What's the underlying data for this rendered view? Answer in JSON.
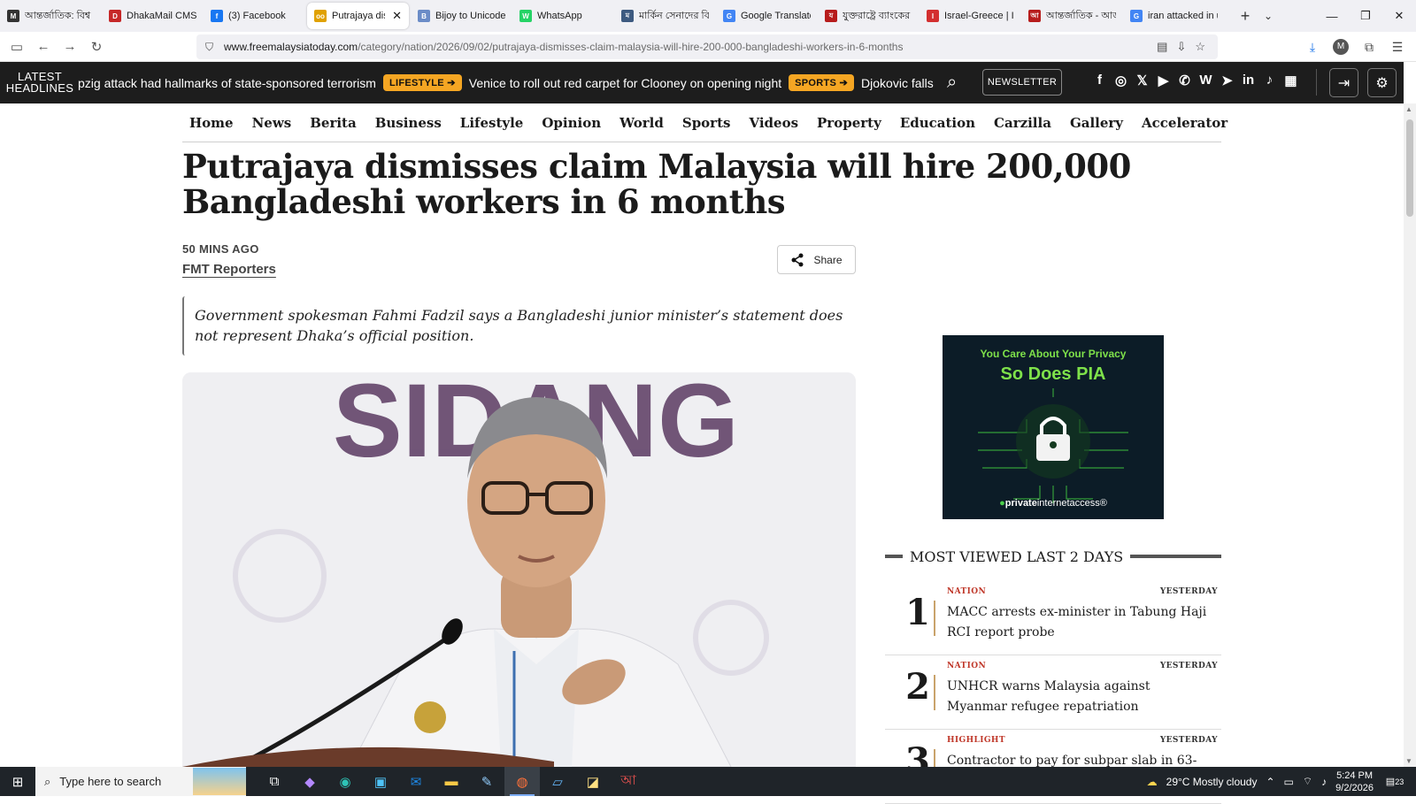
{
  "browser": {
    "tabs": [
      {
        "title": "আন্তর্জাতিক: বিশ্ব",
        "color": "#333333",
        "glyph": "M"
      },
      {
        "title": "DhakaMail CMS",
        "color": "#c62828",
        "glyph": "D"
      },
      {
        "title": "(3) Facebook",
        "color": "#1877f2",
        "glyph": "f"
      },
      {
        "title": "Putrajaya dism",
        "color": "#e0a100",
        "glyph": "oo",
        "active": true
      },
      {
        "title": "Bijoy to Unicode",
        "color": "#6b8cc7",
        "glyph": "B"
      },
      {
        "title": "WhatsApp",
        "color": "#25d366",
        "glyph": "W"
      },
      {
        "title": "মার্কিন সেনাদের বি",
        "color": "#3d5a80",
        "glyph": "ম"
      },
      {
        "title": "Google Translate",
        "color": "#4285f4",
        "glyph": "G"
      },
      {
        "title": "যুক্তরাষ্ট্রে ব্যাংকের",
        "color": "#b71c1c",
        "glyph": "য"
      },
      {
        "title": "Israel-Greece | Isr",
        "color": "#d32f2f",
        "glyph": "I"
      },
      {
        "title": "আন্তর্জাতিক - আজ",
        "color": "#b71c1c",
        "glyph": "আ"
      },
      {
        "title": "iran attacked in us",
        "color": "#4285f4",
        "glyph": "G"
      }
    ],
    "url_domain": "www.freemalaysiatoday.com",
    "url_path": "/category/nation/2026/09/02/putrajaya-dismisses-claim-malaysia-will-hire-200-000-bangladeshi-workers-in-6-months"
  },
  "headlines": {
    "label_line1": "LATEST",
    "label_line2": "HEADLINES",
    "item1": "pzig attack had hallmarks of state-sponsored terrorism",
    "cat1": "LIFESTYLE ➔",
    "item2": "Venice to roll out red carpet for Clooney on opening night",
    "cat2": "SPORTS ➔",
    "item3": "Djokovic falls in US O",
    "newsletter": "NEWSLETTER",
    "socials": [
      "f",
      "◎",
      "𝕏",
      "▶",
      "✆",
      "W",
      "➤",
      "in",
      "♪",
      "▦"
    ]
  },
  "menu": [
    "Home",
    "News",
    "Berita",
    "Business",
    "Lifestyle",
    "Opinion",
    "World",
    "Sports",
    "Videos",
    "Property",
    "Education",
    "Carzilla",
    "Gallery",
    "Accelerator"
  ],
  "article": {
    "title": "Putrajaya dismisses claim Malaysia will hire 200,000 Bangladeshi workers in 6 months",
    "time_ago": "50 MINS AGO",
    "author": "FMT Reporters",
    "share": "Share",
    "lede": "Government spokesman Fahmi Fadzil says a Bangladeshi junior minister’s statement does not represent Dhaka’s official position.",
    "photo_backdrop_text": "SIDANG"
  },
  "ad": {
    "line1": "You Care About Your Privacy",
    "line2": "So Does PIA",
    "brand_bold": "private",
    "brand_rest": "internetaccess"
  },
  "most_viewed": {
    "heading": "MOST VIEWED LAST 2 DAYS",
    "items": [
      {
        "rank": "1",
        "category": "NATION",
        "when": "YESTERDAY",
        "headline": "MACC arrests ex-minister in Tabung Haji RCI report probe"
      },
      {
        "rank": "2",
        "category": "NATION",
        "when": "YESTERDAY",
        "headline": "UNHCR warns Malaysia against Myanmar refugee repatriation"
      },
      {
        "rank": "3",
        "category": "HIGHLIGHT",
        "when": "YESTERDAY",
        "headline": "Contractor to pay for subpar slab in 63-"
      }
    ]
  },
  "taskbar": {
    "search_placeholder": "Type here to search",
    "weather": "29°C  Mostly cloudy",
    "time": "5:24 PM",
    "date": "9/2/2026",
    "notifications": "23"
  }
}
